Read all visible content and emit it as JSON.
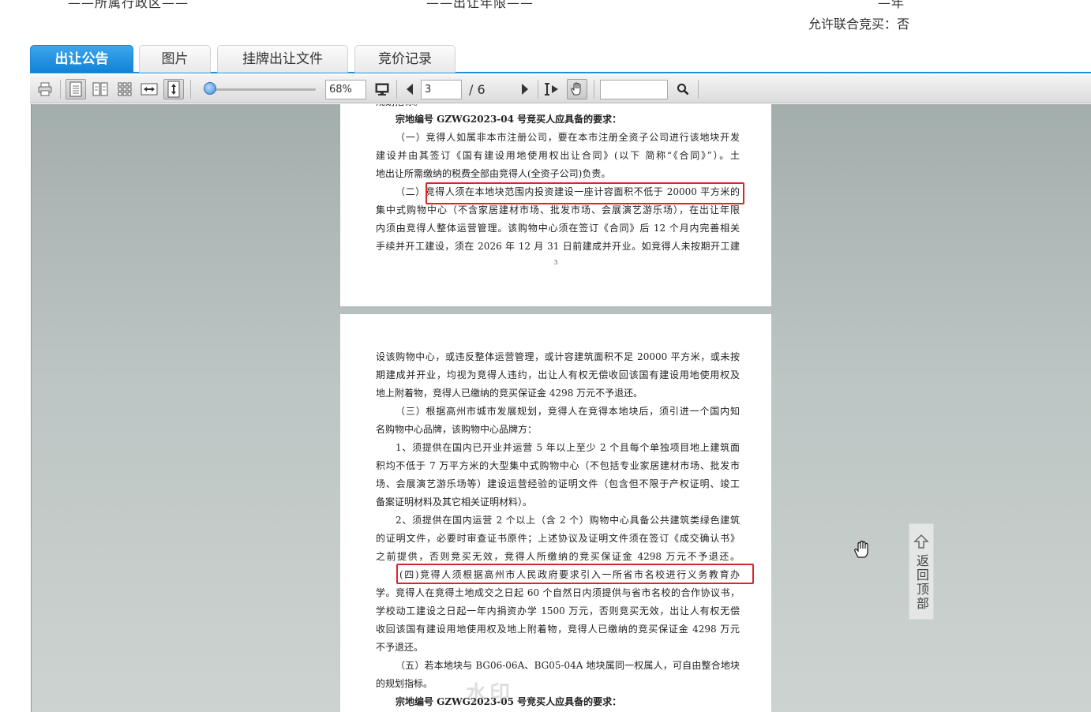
{
  "top": {
    "fragment_left": "——所属行政区——",
    "fragment_mid": "——出让年限——",
    "fragment_right": "—年",
    "joint_bid": "允许联合竞买：否"
  },
  "tabs": [
    {
      "label": "出让公告",
      "active": true
    },
    {
      "label": "图片",
      "active": false
    },
    {
      "label": "挂牌出让文件",
      "active": false
    },
    {
      "label": "竞价记录",
      "active": false
    }
  ],
  "toolbar": {
    "icons": [
      "print-icon",
      "single-page-icon",
      "two-page-icon",
      "thumbnail-grid-icon",
      "fit-width-icon",
      "fit-height-icon",
      "fullscreen-icon",
      "prev-page-icon",
      "next-page-icon",
      "text-select-icon",
      "hand-tool-icon",
      "search-icon"
    ],
    "zoom": "68%",
    "zoom_fraction": 0.05,
    "page_current": "3",
    "page_total": "/ 6",
    "search_placeholder": ""
  },
  "document": {
    "page3_lines": [
      "规划指标。",
      "宗地编号 GZWG2023-04 号竞买人应具备的要求：",
      "（一）竞得人如属非本市注册公司，要在本市注册全资子公司进行该地块开发",
      "建设并由其签订《国有建设用地使用权出让合同》(以下  简称“《合同》”）。土",
      "地出让所需缴纳的税费全部由竞得人(全资子公司)负责。",
      "（二）竞得人须在本地块范围内投资建设一座计容面积不低于 20000 平方米的",
      "集中式购物中心（不含家居建材市场、批发市场、会展演艺游乐场），在出让年限",
      "内须由竞得人整体运营管理。该购物中心须在签订《合同》后 12 个月内完善相关",
      "手续并开工建设，须在 2026 年 12 月 31 日前建成并开业。如竞得人未按期开工建"
    ],
    "page3_number": "3",
    "page4_lines": [
      "设该购物中心，或违反整体运营管理，或计容建筑面积不足 20000 平方米，或未按",
      "期建成并开业，均视为竞得人违约，出让人有权无偿收回该国有建设用地使用权及",
      "地上附着物，竞得人已缴纳的竞买保证金 4298 万元不予退还。",
      "（三）根据高州市城市发展规划，竞得人在竞得本地块后，须引进一个国内知",
      "名购物中心品牌，该购物中心品牌方：",
      "1、须提供在国内已开业并运营 5 年以上至少 2 个且每个单独项目地上建筑面",
      "积均不低于 7 万平方米的大型集中式购物中心（不包括专业家居建材市场、批发市",
      "场、会展演艺游乐场等）建设运营经验的证明文件（包含但不限于产权证明、竣工",
      "备案证明材料及其它相关证明材料）。",
      "2、须提供在国内运营 2 个以上（含 2 个）购物中心具备公共建筑类绿色建筑",
      "的证明文件，必要时审查证书原件；上述协议及证明文件须在签订《成交确认书》",
      "之前提供，否则竞买无效，竞得人所缴纳的竞买保证金 4298 万元不予退还。",
      "(四)竞得人须根据高州市人民政府要求引入一所省市名校进行义务教育办",
      "学。竞得人在竞得土地成交之日起 60 个自然日内须提供与省市名校的合作协议书，",
      "学校动工建设之日起一年内捐资办学 1500 万元，否则竞买无效，出让人有权无偿",
      "收回该国有建设用地使用权及地上附着物，竞得人已缴纳的竞买保证金 4298 万元",
      "不予退还。",
      "（五）若本地块与 BG06-06A、BG05-04A 地块属同一权属人，可自由整合地块",
      "的规划指标。",
      "宗地编号 GZWG2023-05 号竞买人应具备的要求："
    ]
  },
  "back_to_top": "返回顶部",
  "watermark": "水印"
}
